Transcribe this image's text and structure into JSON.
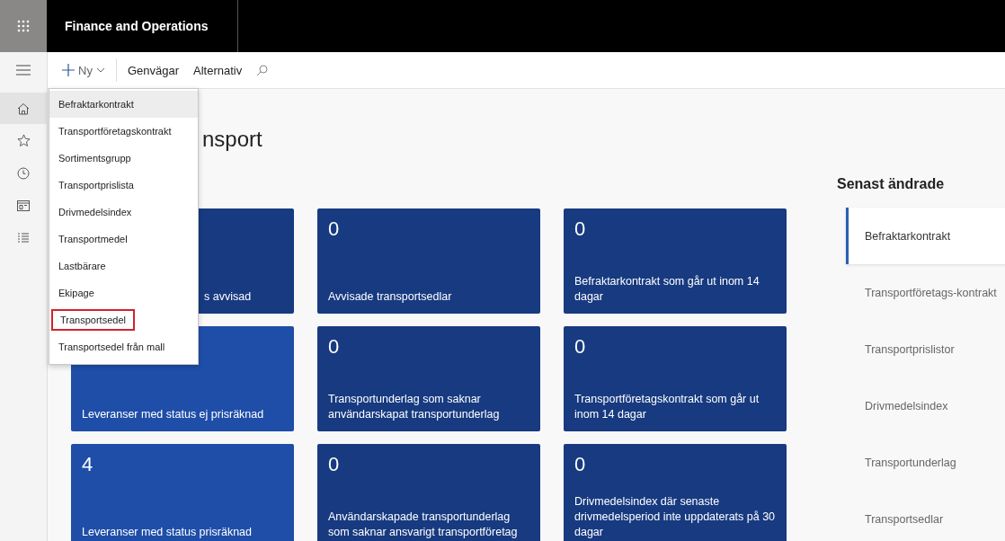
{
  "app": {
    "title": "Finance and Operations"
  },
  "toolbar": {
    "new_button": "Ny",
    "items": [
      "Genvägar",
      "Alternativ"
    ]
  },
  "nav_rail": [
    {
      "kind": "home",
      "selected": true
    },
    {
      "kind": "star",
      "selected": false
    },
    {
      "kind": "clock",
      "selected": false
    },
    {
      "kind": "workspace",
      "selected": false
    },
    {
      "kind": "list",
      "selected": false
    }
  ],
  "new_menu": [
    {
      "label": "Befraktarkontrakt",
      "hovered": true,
      "outlined": false
    },
    {
      "label": "Transportföretagskontrakt",
      "hovered": false,
      "outlined": false
    },
    {
      "label": "Sortimentsgrupp",
      "hovered": false,
      "outlined": false
    },
    {
      "label": "Transportprislista",
      "hovered": false,
      "outlined": false
    },
    {
      "label": "Drivmedelsindex",
      "hovered": false,
      "outlined": false
    },
    {
      "label": "Transportmedel",
      "hovered": false,
      "outlined": false
    },
    {
      "label": "Lastbärare",
      "hovered": false,
      "outlined": false
    },
    {
      "label": "Ekipage",
      "hovered": false,
      "outlined": false
    },
    {
      "label": "Transportsedel",
      "hovered": false,
      "outlined": true
    },
    {
      "label": "Transportsedel från mall",
      "hovered": false,
      "outlined": false
    }
  ],
  "page_title": "nsport",
  "tiles": [
    {
      "label": "s avvisad",
      "partially_hidden": true,
      "color": "#173a80"
    },
    {
      "count": "0",
      "label": "Avvisade transportsedlar",
      "partially_hidden": false,
      "color": "#173a80"
    },
    {
      "count": "0",
      "label": "Befraktarkontrakt som går ut inom 14 dagar",
      "partially_hidden": false,
      "color": "#173a80"
    },
    {
      "label": "Leveranser med status ej prisräknad",
      "partially_hidden": false,
      "color": "#1f4ea8"
    },
    {
      "count": "0",
      "label": "Transportunderlag som saknar användarskapat transportunderlag",
      "partially_hidden": false,
      "color": "#173a80"
    },
    {
      "count": "0",
      "label": "Transportföretagskontrakt som går ut inom 14 dagar",
      "partially_hidden": false,
      "color": "#173a80"
    },
    {
      "count": "4",
      "label": "Leveranser med status prisräknad",
      "partially_hidden": false,
      "color": "#1f4ea8"
    },
    {
      "count": "0",
      "label": "Användarskapade transportunderlag som saknar ansvarigt transportföretag",
      "partially_hidden": false,
      "color": "#173a80"
    },
    {
      "count": "0",
      "label": "Drivmedelsindex där senaste drivmedelsperiod inte uppdaterats på 30 dagar",
      "partially_hidden": false,
      "color": "#173a80"
    }
  ],
  "recent": {
    "title": "Senast ändrade",
    "items": [
      {
        "label": "Befraktarkontrakt",
        "selected": true
      },
      {
        "label": "Transportföretags-kontrakt",
        "selected": false
      },
      {
        "label": "Transportprislistor",
        "selected": false
      },
      {
        "label": "Drivmedelsindex",
        "selected": false
      },
      {
        "label": "Transportunderlag",
        "selected": false
      },
      {
        "label": "Transportsedlar",
        "selected": false
      }
    ]
  }
}
